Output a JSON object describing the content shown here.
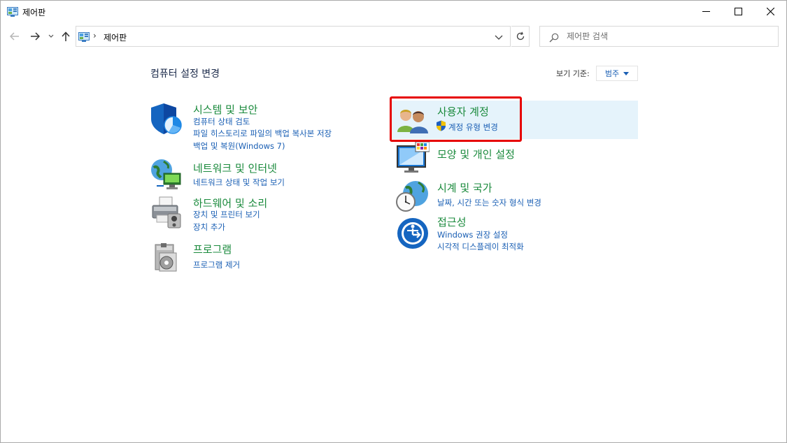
{
  "window": {
    "title": "제어판",
    "minimize_icon": "minimize-icon",
    "maximize_icon": "maximize-icon",
    "close_icon": "close-icon"
  },
  "nav": {
    "back_icon": "arrow-left-icon",
    "forward_icon": "arrow-right-icon",
    "recent_icon": "chevron-down-icon",
    "up_icon": "arrow-up-icon",
    "address": {
      "icon": "control-panel-icon",
      "separator": "›",
      "path": "제어판",
      "dropdown_icon": "chevron-down-icon"
    },
    "refresh_icon": "refresh-icon",
    "search": {
      "icon": "search-icon",
      "placeholder": "제어판 검색",
      "value": ""
    }
  },
  "content": {
    "title": "컴퓨터 설정 변경",
    "view_by_label": "보기 기준:",
    "view_by_value": "범주"
  },
  "categories": {
    "system": {
      "icon": "shield-icon",
      "title": "시스템 및 보안",
      "links": [
        "컴퓨터 상태 검토",
        "파일 히스토리로 파일의 백업 복사본 저장",
        "백업 및 복원(Windows 7)"
      ]
    },
    "network": {
      "icon": "network-globe-icon",
      "title": "네트워크 및 인터넷",
      "links": [
        "네트워크 상태 및 작업 보기"
      ]
    },
    "hardware": {
      "icon": "printer-icon",
      "title": "하드웨어 및 소리",
      "links": [
        "장치 및 프린터 보기",
        "장치 추가"
      ]
    },
    "programs": {
      "icon": "programs-icon",
      "title": "프로그램",
      "links": [
        "프로그램 제거"
      ]
    },
    "accounts": {
      "icon": "users-icon",
      "title": "사용자 계정",
      "links": [
        "계정 유형 변경"
      ],
      "link_icon": "uac-shield-icon"
    },
    "appearance": {
      "icon": "monitor-palette-icon",
      "title": "모양 및 개인 설정",
      "links": []
    },
    "clock": {
      "icon": "clock-globe-icon",
      "title": "시계 및 국가",
      "links": [
        "날짜, 시간 또는 숫자 형식 변경"
      ]
    },
    "access": {
      "icon": "ease-of-access-icon",
      "title": "접근성",
      "links": [
        "Windows 권장 설정",
        "시각적 디스플레이 최적화"
      ]
    }
  },
  "colors": {
    "category_title": "#1a8a3c",
    "link": "#1a5fb4",
    "hover_bg": "#e5f3fb",
    "annotation": "#e60000"
  }
}
